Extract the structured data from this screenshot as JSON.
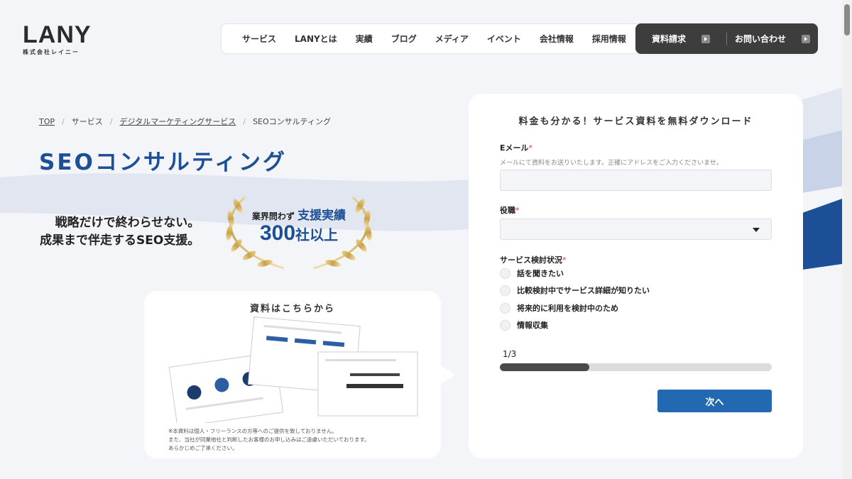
{
  "header": {
    "logo": "LANY",
    "logo_sub": "株式会社レイニー",
    "nav": [
      "サービス",
      "LANYとは",
      "実績",
      "ブログ",
      "メディア",
      "イベント",
      "会社情報",
      "採用情報"
    ],
    "cta_docs": "資料請求",
    "cta_contact": "お問い合わせ"
  },
  "breadcrumb": [
    "TOP",
    "サービス",
    "デジタルマーケティングサービス",
    "SEOコンサルティング"
  ],
  "hero": {
    "title": "SEOコンサルティング",
    "tagline_1": "戦略だけで終わらせない。",
    "tagline_2": "成果まで伴走するSEO支援。",
    "award_lead": "業界問わず",
    "award_strong": "支援実績",
    "award_number": "300",
    "award_unit": "社以上"
  },
  "doc_card": {
    "title": "資料はこちらから",
    "note_1": "※本資料は個人・フリーランスの方等へのご提供を致しておりません。",
    "note_2": "また、当社が同業他社と判断したお客様のお申し込みはご遠慮いただいております。",
    "note_3": "あらかじめご了承ください。"
  },
  "form": {
    "title": "料金も分かる！サービス資料を無料ダウンロード",
    "email_label": "Eメール",
    "email_help": "メールにて資料をお送りいたします。正確にアドレスをご入力くださいませ。",
    "role_label": "役職",
    "status_label": "サービス検討状況",
    "required_mark": "*",
    "options": [
      "話を聞きたい",
      "比較検討中でサービス詳細が知りたい",
      "将来的に利用を検討中のため",
      "情報収集"
    ],
    "step": "1/3",
    "progress": 0.33,
    "next": "次へ"
  }
}
